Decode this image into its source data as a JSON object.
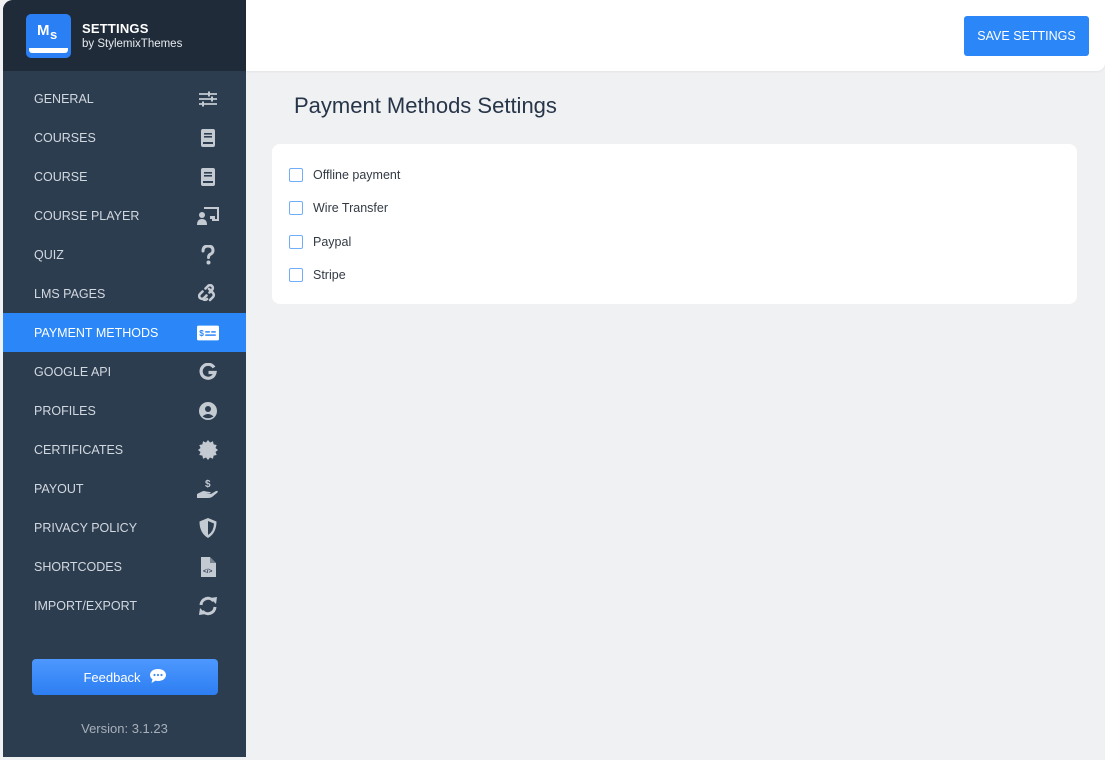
{
  "brand": {
    "logo_text_m": "M",
    "logo_text_s": "s",
    "title": "SETTINGS",
    "subtitle": "by StylemixThemes"
  },
  "sidebar": {
    "items": [
      {
        "label": "GENERAL",
        "icon": "sliders-icon",
        "active": false
      },
      {
        "label": "COURSES",
        "icon": "book-icon",
        "active": false
      },
      {
        "label": "COURSE",
        "icon": "book-icon",
        "active": false
      },
      {
        "label": "COURSE PLAYER",
        "icon": "chalkboard-teacher-icon",
        "active": false
      },
      {
        "label": "QUIZ",
        "icon": "question-icon",
        "active": false
      },
      {
        "label": "LMS PAGES",
        "icon": "link-icon",
        "active": false
      },
      {
        "label": "PAYMENT METHODS",
        "icon": "money-check-icon",
        "active": true
      },
      {
        "label": "GOOGLE API",
        "icon": "google-icon",
        "active": false
      },
      {
        "label": "PROFILES",
        "icon": "user-circle-icon",
        "active": false
      },
      {
        "label": "CERTIFICATES",
        "icon": "certificate-icon",
        "active": false
      },
      {
        "label": "PAYOUT",
        "icon": "hand-holding-dollar-icon",
        "active": false
      },
      {
        "label": "PRIVACY POLICY",
        "icon": "shield-icon",
        "active": false
      },
      {
        "label": "SHORTCODES",
        "icon": "file-code-icon",
        "active": false
      },
      {
        "label": "IMPORT/EXPORT",
        "icon": "sync-icon",
        "active": false
      }
    ],
    "feedback_label": "Feedback",
    "version": "Version: 3.1.23"
  },
  "toolbar": {
    "save_label": "SAVE SETTINGS"
  },
  "main": {
    "title": "Payment Methods Settings",
    "options": [
      {
        "label": "Offline payment",
        "checked": false
      },
      {
        "label": "Wire Transfer",
        "checked": false
      },
      {
        "label": "Paypal",
        "checked": false
      },
      {
        "label": "Stripe",
        "checked": false
      }
    ]
  },
  "colors": {
    "accent": "#2b86f7",
    "sidebar_bg": "#2d3d50",
    "brand_bg": "#1f2b38",
    "page_bg": "#f0f1f3"
  }
}
